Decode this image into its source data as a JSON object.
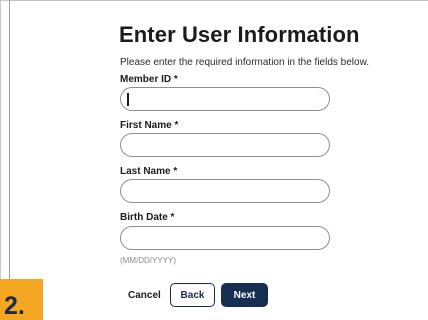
{
  "form": {
    "title": "Enter User Information",
    "instructions": "Please enter the required information in the fields below.",
    "fields": [
      {
        "label": "Member ID *",
        "value": "",
        "focused": true
      },
      {
        "label": "First Name *",
        "value": ""
      },
      {
        "label": "Last Name *",
        "value": ""
      },
      {
        "label": "Birth Date *",
        "value": "",
        "hint": "(MM/DD/YYYY)"
      }
    ]
  },
  "actions": {
    "cancel_label": "Cancel",
    "back_label": "Back",
    "next_label": "Next"
  },
  "step": {
    "number": "2."
  },
  "colors": {
    "primary": "#162e51",
    "badge": "#f5a623",
    "field_border": "#8e8e8e",
    "hint_text": "#8a8a8a"
  }
}
